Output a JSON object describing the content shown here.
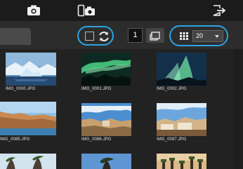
{
  "toolbar": {
    "page_count": "1",
    "per_page_value": "20"
  },
  "thumbnails": [
    {
      "filename": "IMG_0000.JPG"
    },
    {
      "filename": "IMG_0001.JPG"
    },
    {
      "filename": "IMG_0002.JPG"
    },
    {
      "filename": "IMG_0085.JPG"
    },
    {
      "filename": "IMG_0086.JPG"
    },
    {
      "filename": "IMG_0087.JPG"
    }
  ],
  "colors": {
    "highlight": "#2aa4e2",
    "topbar": "#1b1b1b",
    "background": "#222222"
  },
  "icons": [
    "camera-icon",
    "remote-camera-icon",
    "exit-icon",
    "refresh-icon",
    "layout-icon",
    "grid-icon",
    "dropdown-caret-icon"
  ]
}
